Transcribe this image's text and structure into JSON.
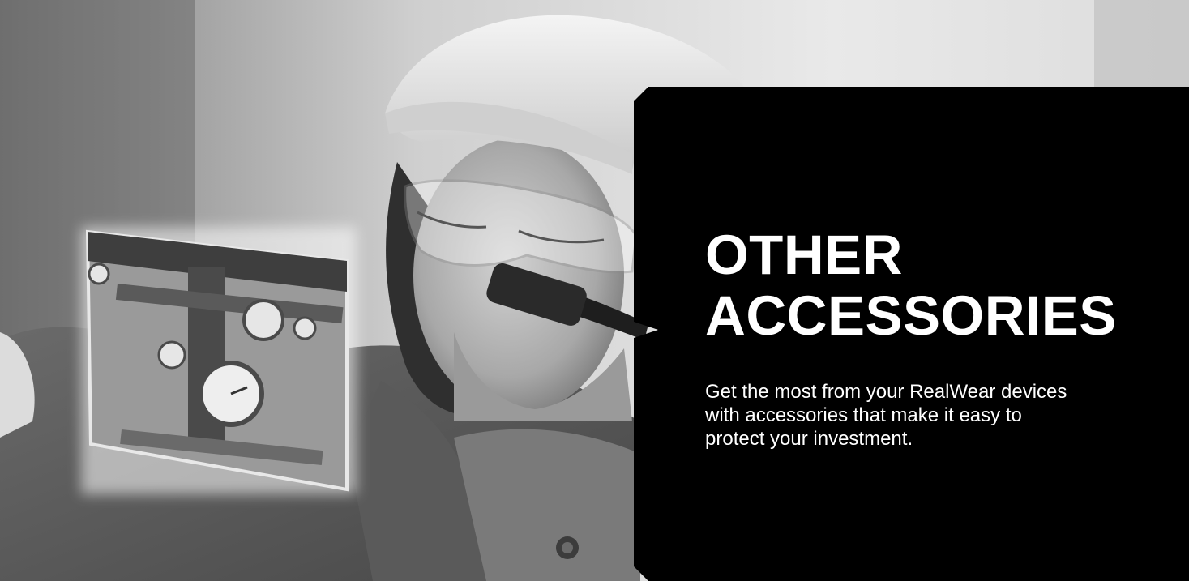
{
  "panel": {
    "title_line1": "OTHER",
    "title_line2": "ACCESSORIES",
    "description": "Get the most from your RealWear devices with accessories that make it easy to protect your investment.",
    "background_color": "#000000",
    "text_color": "#ffffff"
  },
  "photo": {
    "icon": "worker-with-headset-photo"
  }
}
